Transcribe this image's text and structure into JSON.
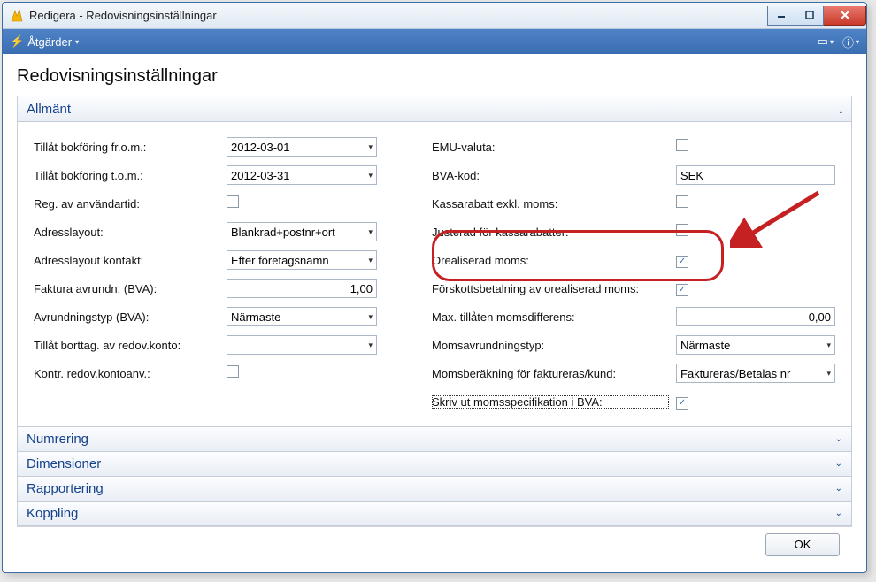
{
  "window": {
    "title": "Redigera - Redovisningsinställningar"
  },
  "toolbar": {
    "actions": "Åtgärder"
  },
  "page": {
    "title": "Redovisningsinställningar"
  },
  "panes": {
    "general": "Allmänt",
    "numbering": "Numrering",
    "dimensions": "Dimensioner",
    "reporting": "Rapportering",
    "coupling": "Koppling"
  },
  "left": {
    "allow_from_label": "Tillåt bokföring fr.o.m.:",
    "allow_from_value": "2012-03-01",
    "allow_to_label": "Tillåt bokföring t.o.m.:",
    "allow_to_value": "2012-03-31",
    "reg_user_label": "Reg. av användartid:",
    "addr_layout_label": "Adresslayout:",
    "addr_layout_value": "Blankrad+postnr+ort",
    "addr_layout_contact_label": "Adresslayout kontakt:",
    "addr_layout_contact_value": "Efter företagsnamn",
    "inv_round_label": "Faktura avrundn. (BVA):",
    "inv_round_value": "1,00",
    "round_type_label": "Avrundningstyp (BVA):",
    "round_type_value": "Närmaste",
    "allow_del_label": "Tillåt borttag. av redov.konto:",
    "allow_del_value": "",
    "kontr_label": "Kontr. redov.kontoanv.:"
  },
  "right": {
    "emu_label": "EMU-valuta:",
    "bva_label": "BVA-kod:",
    "bva_value": "SEK",
    "cashdisc_label": "Kassarabatt exkl. moms:",
    "adjusted_label": "Justerad för kassarabatter:",
    "unrealized_label": "Orealiserad moms:",
    "prepay_label": "Förskottsbetalning av orealiserad moms:",
    "maxdiff_label": "Max. tillåten momsdifferens:",
    "maxdiff_value": "0,00",
    "vatround_label": "Momsavrundningstyp:",
    "vatround_value": "Närmaste",
    "vatcalc_label": "Momsberäkning för faktureras/kund:",
    "vatcalc_value": "Faktureras/Betalas nr",
    "print_label": "Skriv ut momsspecifikation i BVA:"
  },
  "footer": {
    "ok": "OK"
  }
}
